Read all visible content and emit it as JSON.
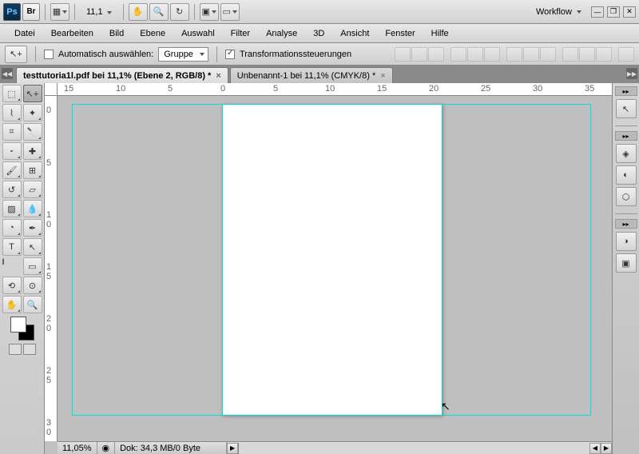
{
  "top": {
    "ps": "Ps",
    "br": "Br",
    "zoom": "11,1",
    "workflow": "Workflow"
  },
  "menu": [
    "Datei",
    "Bearbeiten",
    "Bild",
    "Ebene",
    "Auswahl",
    "Filter",
    "Analyse",
    "3D",
    "Ansicht",
    "Fenster",
    "Hilfe"
  ],
  "options": {
    "auto_select": "Automatisch auswählen:",
    "auto_select_value": "Gruppe",
    "show_transform": "Transformationssteuerungen"
  },
  "tabs": [
    {
      "label": "testtutoria1l.pdf bei 11,1% (Ebene 2, RGB/8) *",
      "active": true
    },
    {
      "label": "Unbenannt-1 bei 11,1% (CMYK/8) *",
      "active": false
    }
  ],
  "ruler_h": [
    "15",
    "10",
    "5",
    "0",
    "5",
    "10",
    "15",
    "20",
    "25",
    "30",
    "35"
  ],
  "ruler_v": [
    "0",
    "5",
    "1\n0",
    "1\n5",
    "2\n0",
    "2\n5",
    "3\n0"
  ],
  "status": {
    "zoom": "11,05%",
    "doc": "Dok: 34,3 MB/0 Byte"
  },
  "colors": {
    "fg": "#ffffff",
    "bg": "#000000",
    "guide": "#00e0e0"
  }
}
